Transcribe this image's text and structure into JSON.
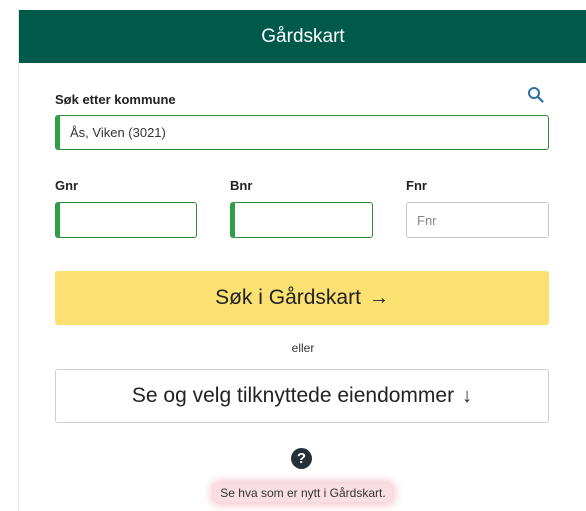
{
  "header": {
    "title": "Gårdskart"
  },
  "search": {
    "label": "Søk etter kommune",
    "value": "Ås, Viken (3021)",
    "icon": "search-icon"
  },
  "fields": {
    "gnr": {
      "label": "Gnr",
      "value": "",
      "placeholder": ""
    },
    "bnr": {
      "label": "Bnr",
      "value": "",
      "placeholder": ""
    },
    "fnr": {
      "label": "Fnr",
      "value": "",
      "placeholder": "Fnr"
    }
  },
  "actions": {
    "search_button": "Søk i Gårdskart",
    "search_arrow": "→",
    "or_text": "eller",
    "properties_button": "Se og velg tilknyttede eiendommer",
    "properties_arrow": "↓"
  },
  "footer": {
    "help_glyph": "?",
    "news_link": "Se hva som er nytt i Gårdskart."
  },
  "colors": {
    "header": "#005a4b",
    "field_accent": "#2ca043",
    "primary_button": "#fbe072",
    "search_icon": "#2f6fa3"
  }
}
